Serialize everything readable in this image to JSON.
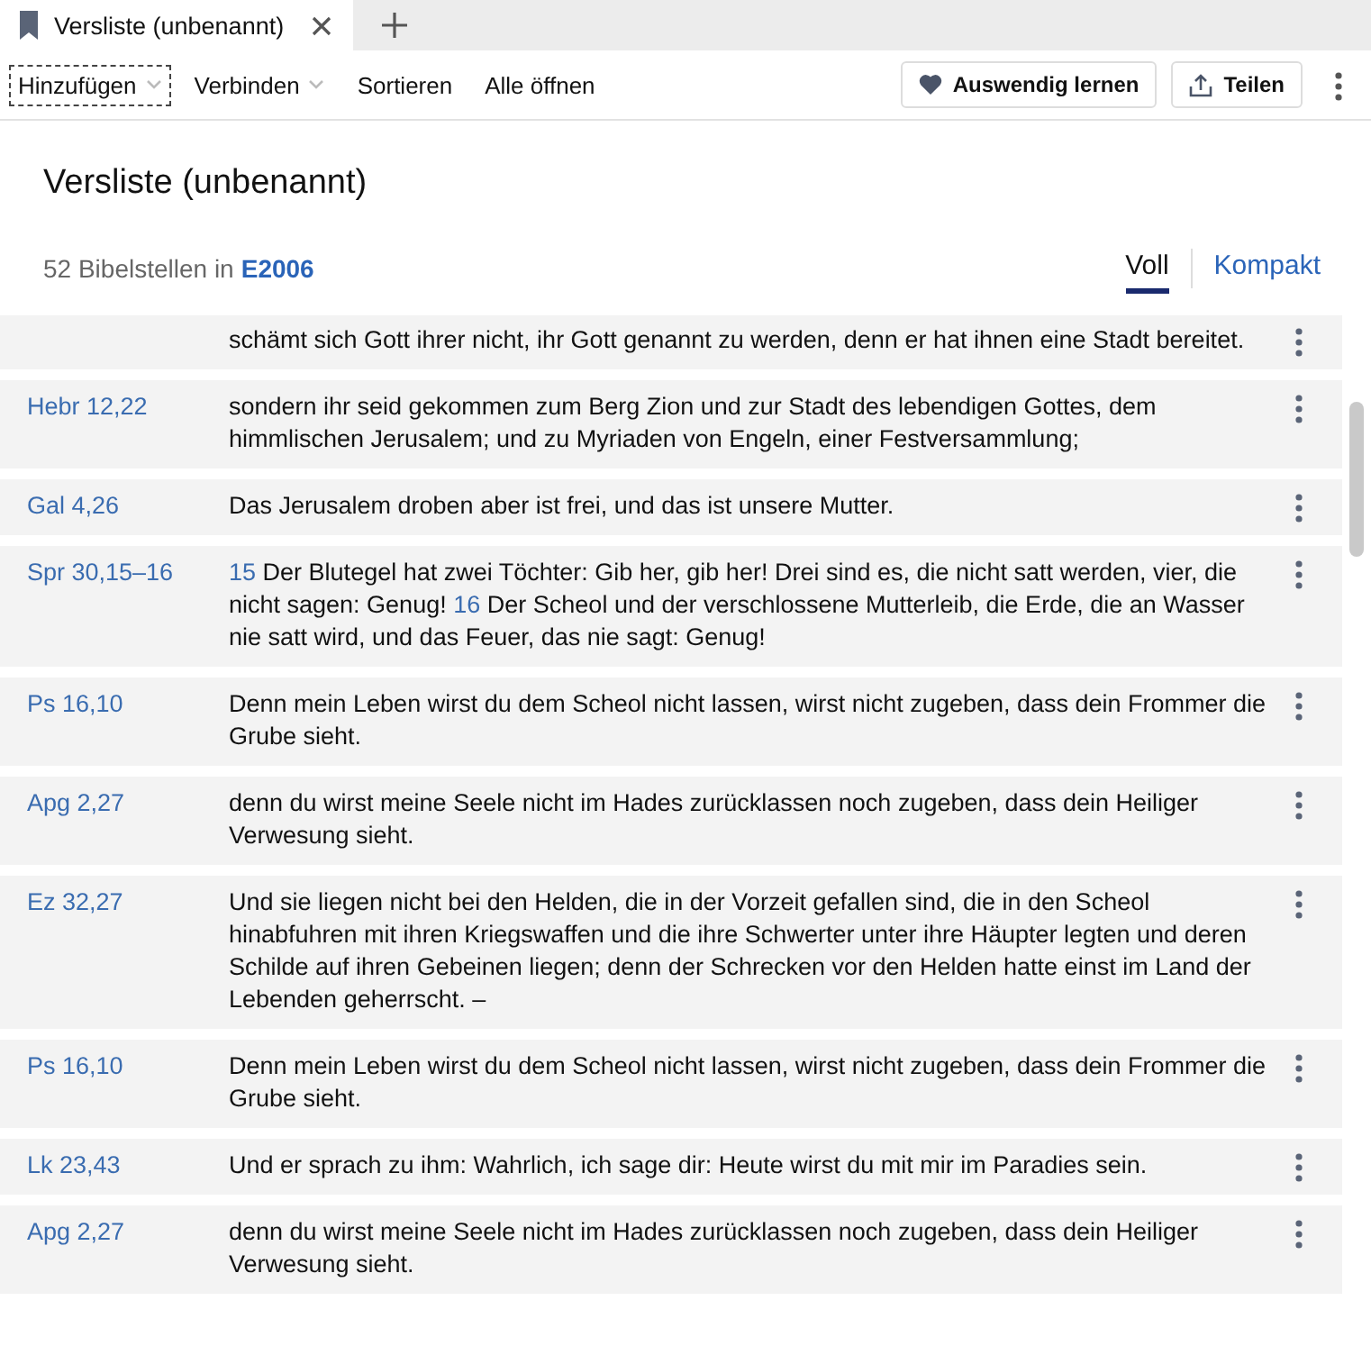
{
  "tabs": [
    {
      "title": "Versliste (unbenannt)",
      "selected": true
    }
  ],
  "toolbar": {
    "menus": [
      {
        "label": "Hinzufügen",
        "kind": "dropdown",
        "focused": true
      },
      {
        "label": "Verbinden",
        "kind": "dropdown",
        "focused": false
      },
      {
        "label": "Sortieren",
        "kind": "plain",
        "focused": false
      },
      {
        "label": "Alle öffnen",
        "kind": "plain",
        "focused": false
      }
    ],
    "buttons": [
      {
        "label": "Auswendig lernen",
        "kind": "heart"
      },
      {
        "label": "Teilen",
        "kind": "share"
      }
    ]
  },
  "header": {
    "title": "Versliste (unbenannt)",
    "count": "52 Bibelstellen in",
    "version": "E2006",
    "views": [
      {
        "label": "Voll",
        "selected": true
      },
      {
        "label": "Kompakt",
        "selected": false
      }
    ]
  },
  "rows": [
    {
      "parts": [
        {
          "kind": "text",
          "text": "schämt sich Gott ihrer nicht, ihr Gott genannt zu werden, denn er hat ihnen eine Stadt bereitet."
        }
      ]
    },
    {
      "ref": "Hebr 12,22",
      "parts": [
        {
          "kind": "text",
          "text": "sondern ihr seid gekommen zum Berg Zion und zur Stadt des lebendigen Gottes, dem himmlischen Jerusalem; und zu Myriaden von Engeln, einer Festversammlung;"
        }
      ]
    },
    {
      "ref": "Gal 4,26",
      "parts": [
        {
          "kind": "text",
          "text": "Das Jerusalem droben aber ist frei, und das ist unsere Mutter."
        }
      ]
    },
    {
      "ref": "Spr 30,15–16",
      "parts": [
        {
          "kind": "verse",
          "text": "15"
        },
        {
          "kind": "text",
          "text": "Der Blutegel hat zwei Töchter: Gib her, gib her! Drei sind es, die nicht satt werden, vier, die nicht sagen: Genug!"
        },
        {
          "kind": "verse",
          "text": "16"
        },
        {
          "kind": "text",
          "text": "Der Scheol und der verschlossene Mutterleib, die Erde, die an Wasser nie satt wird, und das Feuer, das nie sagt: Genug!"
        }
      ]
    },
    {
      "ref": "Ps 16,10",
      "parts": [
        {
          "kind": "text",
          "text": "Denn mein Leben wirst du dem Scheol nicht lassen, wirst nicht zugeben, dass dein Frommer die Grube sieht."
        }
      ]
    },
    {
      "ref": "Apg 2,27",
      "parts": [
        {
          "kind": "text",
          "text": "denn du wirst meine Seele nicht im Hades zurücklassen noch zugeben, dass dein Heiliger Verwesung sieht."
        }
      ]
    },
    {
      "ref": "Ez 32,27",
      "parts": [
        {
          "kind": "text",
          "text": "Und sie liegen nicht bei den Helden, die in der Vorzeit gefallen sind, die in den Scheol hinabfuhren mit ihren Kriegswaffen und die ihre Schwerter unter ihre Häupter legten und deren Schilde auf ihren Gebeinen liegen; denn der Schrecken vor den Helden hatte einst im Land der Lebenden geherrscht. –"
        }
      ]
    },
    {
      "ref": "Ps 16,10",
      "parts": [
        {
          "kind": "text",
          "text": "Denn mein Leben wirst du dem Scheol nicht lassen, wirst nicht zugeben, dass dein Frommer die Grube sieht."
        }
      ]
    },
    {
      "ref": "Lk 23,43",
      "parts": [
        {
          "kind": "text",
          "text": "Und er sprach zu ihm: Wahrlich, ich sage dir: Heute wirst du mit mir im Paradies sein."
        }
      ]
    },
    {
      "ref": "Apg 2,27",
      "parts": [
        {
          "kind": "text",
          "text": "denn du wirst meine Seele nicht im Hades zurücklassen noch zugeben, dass dein Heiliger Verwesung sieht."
        }
      ]
    }
  ]
}
